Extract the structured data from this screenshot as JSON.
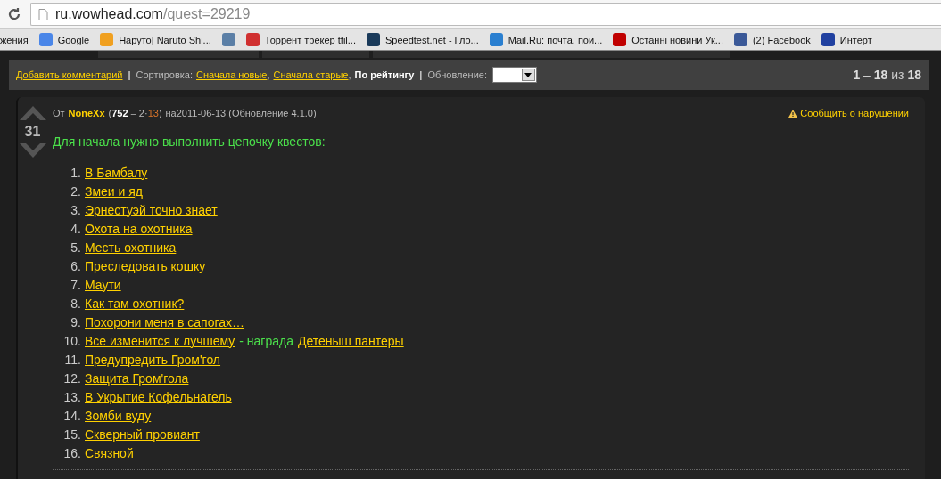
{
  "address_bar": {
    "domain": "ru.wowhead.com",
    "path": "/quest=29219"
  },
  "bookmarks": [
    {
      "label": "жения"
    },
    {
      "label": "Google",
      "color": "#4a86e8"
    },
    {
      "label": "Наруто| Naruto Shi...",
      "color": "#f0a020"
    },
    {
      "color": "#5b7fa6"
    },
    {
      "label": "Торрент трекер tfil...",
      "color": "#d03030"
    },
    {
      "label": "Speedtest.net - Гло...",
      "color": "#1a3a5a"
    },
    {
      "label": "Mail.Ru: почта, пои...",
      "color": "#2a7fd0"
    },
    {
      "label": "Останні новини Ук...",
      "color": "#c00000"
    },
    {
      "label": "(2) Facebook",
      "color": "#3b5998"
    },
    {
      "label": "Интерт",
      "color": "#2040a0"
    }
  ],
  "toolbar": {
    "add_comment": "Добавить комментарий",
    "sort_label": "Сортировка:",
    "separator": "|",
    "sort_options": [
      {
        "label": "Сначала новые",
        "selected": false,
        "after": ","
      },
      {
        "label": "Сначала старые",
        "selected": false,
        "after": ","
      },
      {
        "label": "По рейтингу",
        "selected": true
      }
    ],
    "update_label": "Обновление:",
    "pager": {
      "from": "1",
      "dash": "–",
      "to": "18",
      "of": "из",
      "total": "18"
    }
  },
  "comment": {
    "score": "31",
    "by": "От",
    "author": "NoneXx",
    "rating": {
      "open": "(",
      "score": "752",
      "dash": "–",
      "r2": "2·",
      "r3": "13",
      "close": ")"
    },
    "date": "на2011-06-13",
    "patch": "(Обновление 4.1.0)",
    "report": "Сообщить о нарушении",
    "intro": "Для начала нужно выполнить цепочку квестов:",
    "items": [
      {
        "number": "1.",
        "parts": [
          {
            "kind": "link",
            "text": "В Бамбалу"
          }
        ]
      },
      {
        "number": "2.",
        "parts": [
          {
            "kind": "link",
            "text": "Змеи и яд"
          }
        ]
      },
      {
        "number": "3.",
        "parts": [
          {
            "kind": "link",
            "text": "Эрнестуэй точно знает"
          }
        ]
      },
      {
        "number": "4.",
        "parts": [
          {
            "kind": "link",
            "text": "Охота на охотника"
          }
        ]
      },
      {
        "number": "5.",
        "parts": [
          {
            "kind": "link",
            "text": "Месть охотника"
          }
        ]
      },
      {
        "number": "6.",
        "parts": [
          {
            "kind": "link",
            "text": "Преследовать кошку"
          }
        ]
      },
      {
        "number": "7.",
        "parts": [
          {
            "kind": "link",
            "text": "Маути"
          }
        ]
      },
      {
        "number": "8.",
        "parts": [
          {
            "kind": "link",
            "text": "Как там охотник?"
          }
        ]
      },
      {
        "number": "9.",
        "parts": [
          {
            "kind": "link",
            "text": "Похорони меня в сапогах…"
          }
        ]
      },
      {
        "number": "10.",
        "parts": [
          {
            "kind": "link",
            "text": "Все изменится к лучшему"
          },
          {
            "kind": "text",
            "text": "- награда"
          },
          {
            "kind": "link",
            "text": "Детеныш пантеры"
          }
        ]
      },
      {
        "number": "11.",
        "parts": [
          {
            "kind": "link",
            "text": "Предупредить Гром'гол"
          }
        ]
      },
      {
        "number": "12.",
        "parts": [
          {
            "kind": "link",
            "text": "Защита Гром'гола"
          }
        ]
      },
      {
        "number": "13.",
        "parts": [
          {
            "kind": "link",
            "text": "В Укрытие Кофельнагель"
          }
        ]
      },
      {
        "number": "14.",
        "parts": [
          {
            "kind": "link",
            "text": "Зомби вуду"
          }
        ]
      },
      {
        "number": "15.",
        "parts": [
          {
            "kind": "link",
            "text": "Скверный провиант"
          }
        ]
      },
      {
        "number": "16.",
        "parts": [
          {
            "kind": "link",
            "text": "Связной"
          }
        ]
      }
    ]
  }
}
